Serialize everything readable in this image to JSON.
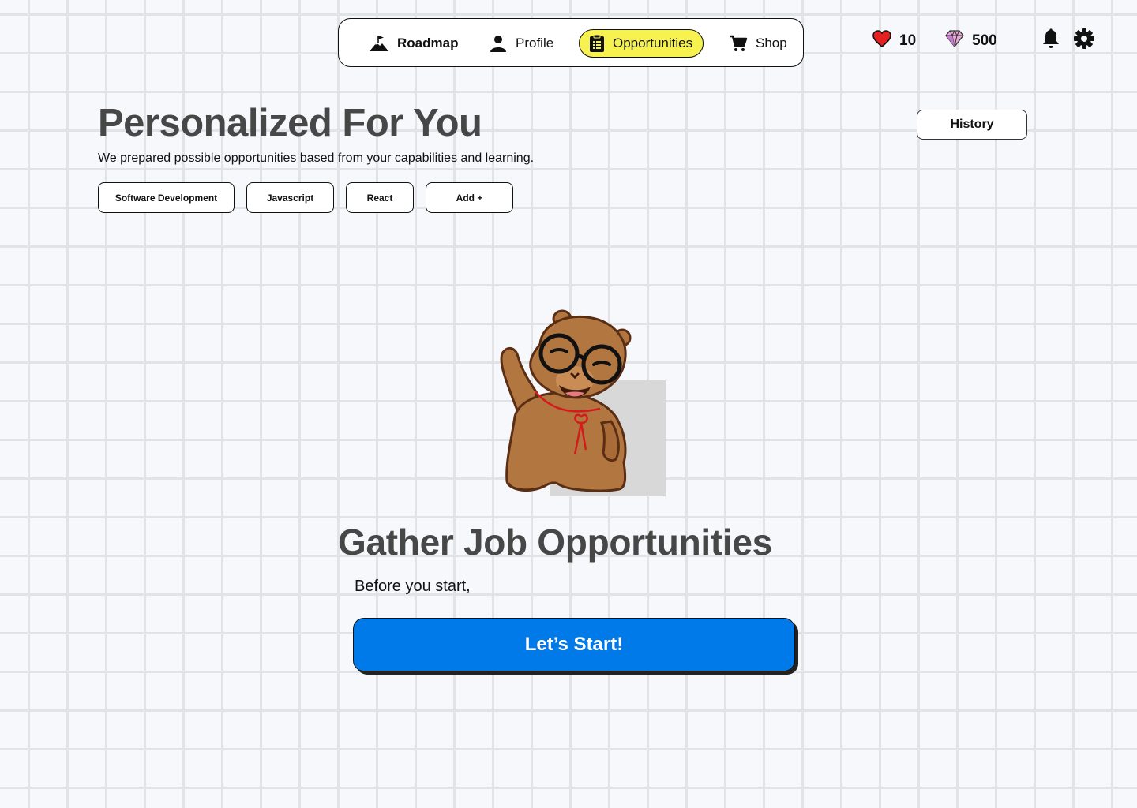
{
  "nav": {
    "items": [
      {
        "label": "Roadmap",
        "icon": "mountain-flag-icon"
      },
      {
        "label": "Profile",
        "icon": "person-icon"
      },
      {
        "label": "Opportunities",
        "icon": "clipboard-list-icon",
        "active": true
      },
      {
        "label": "Shop",
        "icon": "cart-icon"
      }
    ]
  },
  "status": {
    "hearts": "10",
    "gems": "500"
  },
  "header": {
    "title": "Personalized For You",
    "subtitle": "We prepared possible opportunities based from your capabilities and learning.",
    "history_label": "History"
  },
  "chips": [
    {
      "label": "Software Development"
    },
    {
      "label": "Javascript"
    },
    {
      "label": "React"
    },
    {
      "label": "Add +"
    }
  ],
  "main": {
    "title": "Gather Job Opportunities",
    "subtitle": "Before you start,",
    "cta_label": "Let’s Start!"
  },
  "colors": {
    "accent": "#0079e9",
    "active_tab": "#f7f250",
    "heading": "#474747",
    "heart": "#e42020",
    "background": "#f6f8fc"
  }
}
